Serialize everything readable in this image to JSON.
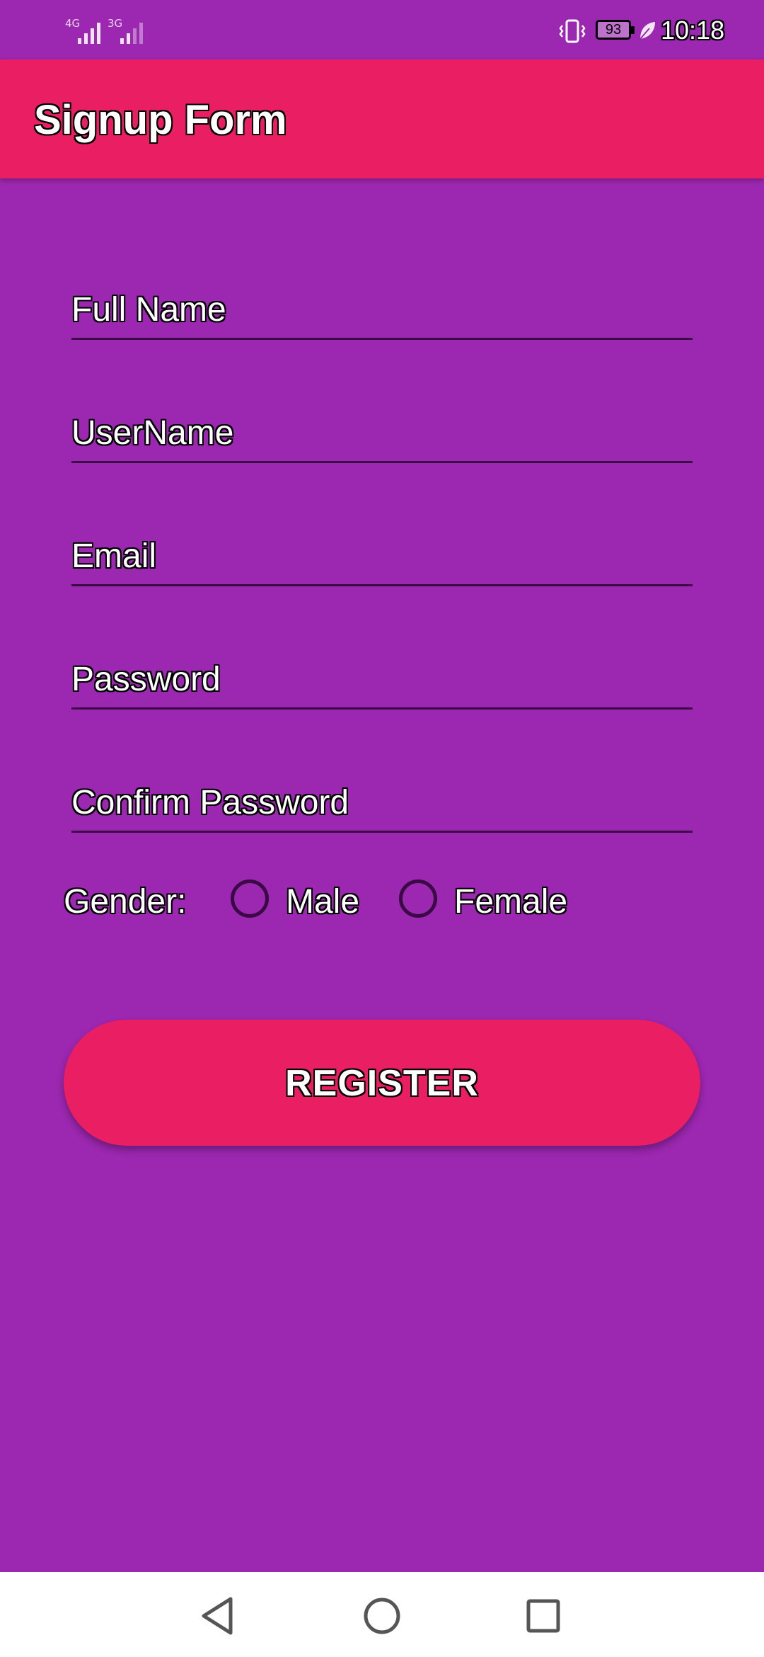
{
  "status_bar": {
    "sim1_network": "4G",
    "sim2_network": "3G",
    "battery": "93",
    "time": "10:18",
    "icons": [
      "signal-icon",
      "vibrate-icon",
      "battery-icon",
      "power-saving-leaf-icon"
    ]
  },
  "app_bar": {
    "title": "Signup Form",
    "color": "#e91e63"
  },
  "form": {
    "fields": [
      {
        "placeholder": "Full Name"
      },
      {
        "placeholder": "UserName"
      },
      {
        "placeholder": "Email"
      },
      {
        "placeholder": "Password"
      },
      {
        "placeholder": "Confirm Password"
      }
    ],
    "gender": {
      "label": "Gender:",
      "options": [
        "Male",
        "Female"
      ]
    },
    "register_label": "REGISTER"
  },
  "nav_bar": {
    "icons": [
      "back-icon",
      "home-icon",
      "recents-icon"
    ]
  },
  "colors": {
    "background": "#9c27b0",
    "accent": "#e91e63"
  }
}
